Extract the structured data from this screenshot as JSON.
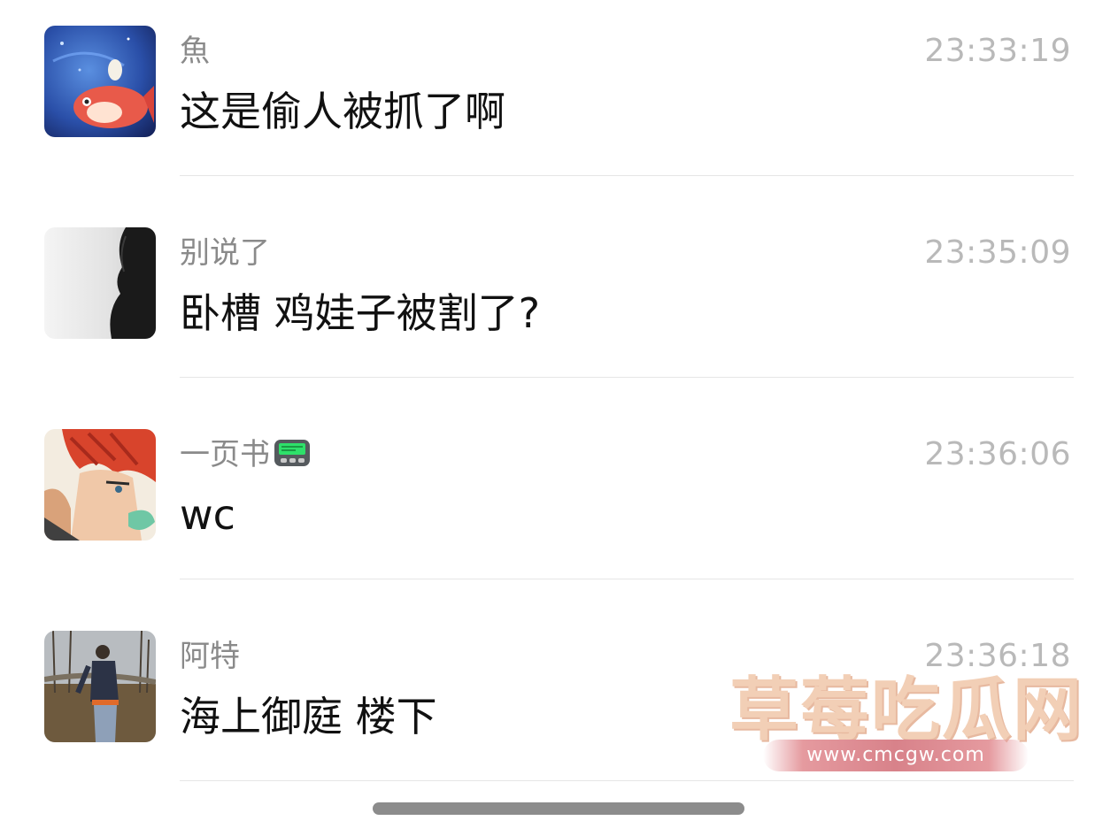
{
  "chats": [
    {
      "name": "魚",
      "time": "23:33:19",
      "message": "这是偷人被抓了啊",
      "avatar": "fish-painting-avatar"
    },
    {
      "name": "别说了",
      "time": "23:35:09",
      "message": "卧槽 鸡娃子被割了?",
      "avatar": "dark-profile-avatar"
    },
    {
      "name": "一页书",
      "time": "23:36:06",
      "message": "wc",
      "avatar": "red-hair-anime-avatar",
      "name_icon": "pager-icon"
    },
    {
      "name": "阿特",
      "time": "23:36:18",
      "message": "海上御庭 楼下",
      "avatar": "field-photo-avatar"
    }
  ],
  "watermark": {
    "title": "草莓吃瓜网",
    "url": "www.cmcgw.com"
  },
  "colors": {
    "name": "#8a8a8a",
    "time": "#b9b9b9",
    "message": "#111111",
    "divider": "#e6e6e6"
  }
}
